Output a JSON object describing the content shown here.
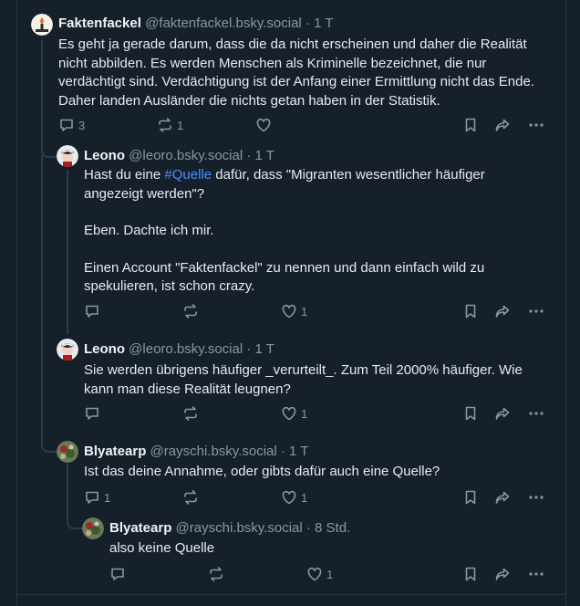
{
  "posts": [
    {
      "name": "Faktenfackel",
      "handle": "@faktenfackel.bsky.social",
      "sep": "·",
      "time": "1 T",
      "paragraphs": [
        "Es geht ja gerade darum, dass die da nicht erscheinen und daher die Realität nicht abbilden. Es werden Menschen als Kriminelle bezeichnet, die nur verdächtigt sind. Verdächtigung ist der Anfang einer Ermittlung nicht das Ende. Daher landen Ausländer die nichts getan haben in der Statistik."
      ],
      "replies": "3",
      "reposts": "1",
      "likes": ""
    },
    {
      "name": "Leono",
      "handle": "@leoro.bsky.social",
      "sep": "·",
      "time": "1 T",
      "p1_pre": "Hast du eine ",
      "p1_tag": "#Quelle",
      "p1_post": " dafür, dass \"Migranten wesentlicher häufiger angezeigt werden\"?",
      "p2": "Eben. Dachte ich mir.",
      "p3": "Einen Account \"Faktenfackel\" zu nennen und dann einfach wild zu spekulieren, ist schon crazy.",
      "replies": "",
      "reposts": "",
      "likes": "1"
    },
    {
      "name": "Leono",
      "handle": "@leoro.bsky.social",
      "sep": "·",
      "time": "1 T",
      "paragraphs": [
        "Sie werden übrigens häufiger _verurteilt_. Zum Teil 2000% häufiger. Wie kann man diese Realität leugnen?"
      ],
      "replies": "",
      "reposts": "",
      "likes": "1"
    },
    {
      "name": "Blyatearp",
      "handle": "@rayschi.bsky.social",
      "sep": "·",
      "time": "1 T",
      "paragraphs": [
        "Ist das deine Annahme, oder gibts dafür auch eine Quelle?"
      ],
      "replies": "1",
      "reposts": "",
      "likes": "1"
    },
    {
      "name": "Blyatearp",
      "handle": "@rayschi.bsky.social",
      "sep": "·",
      "time": "8 Std.",
      "paragraphs": [
        "also keine Quelle"
      ],
      "replies": "",
      "reposts": "",
      "likes": "1"
    }
  ],
  "icons": {
    "reply": "reply-icon",
    "repost": "repost-icon",
    "like": "heart-icon",
    "bookmark": "bookmark-icon",
    "share": "share-icon",
    "more": "more-icon"
  },
  "colors": {
    "background": "#16202b",
    "text": "#e6ebf0",
    "muted": "#8a96a5",
    "hashtag": "#4c8dff"
  }
}
